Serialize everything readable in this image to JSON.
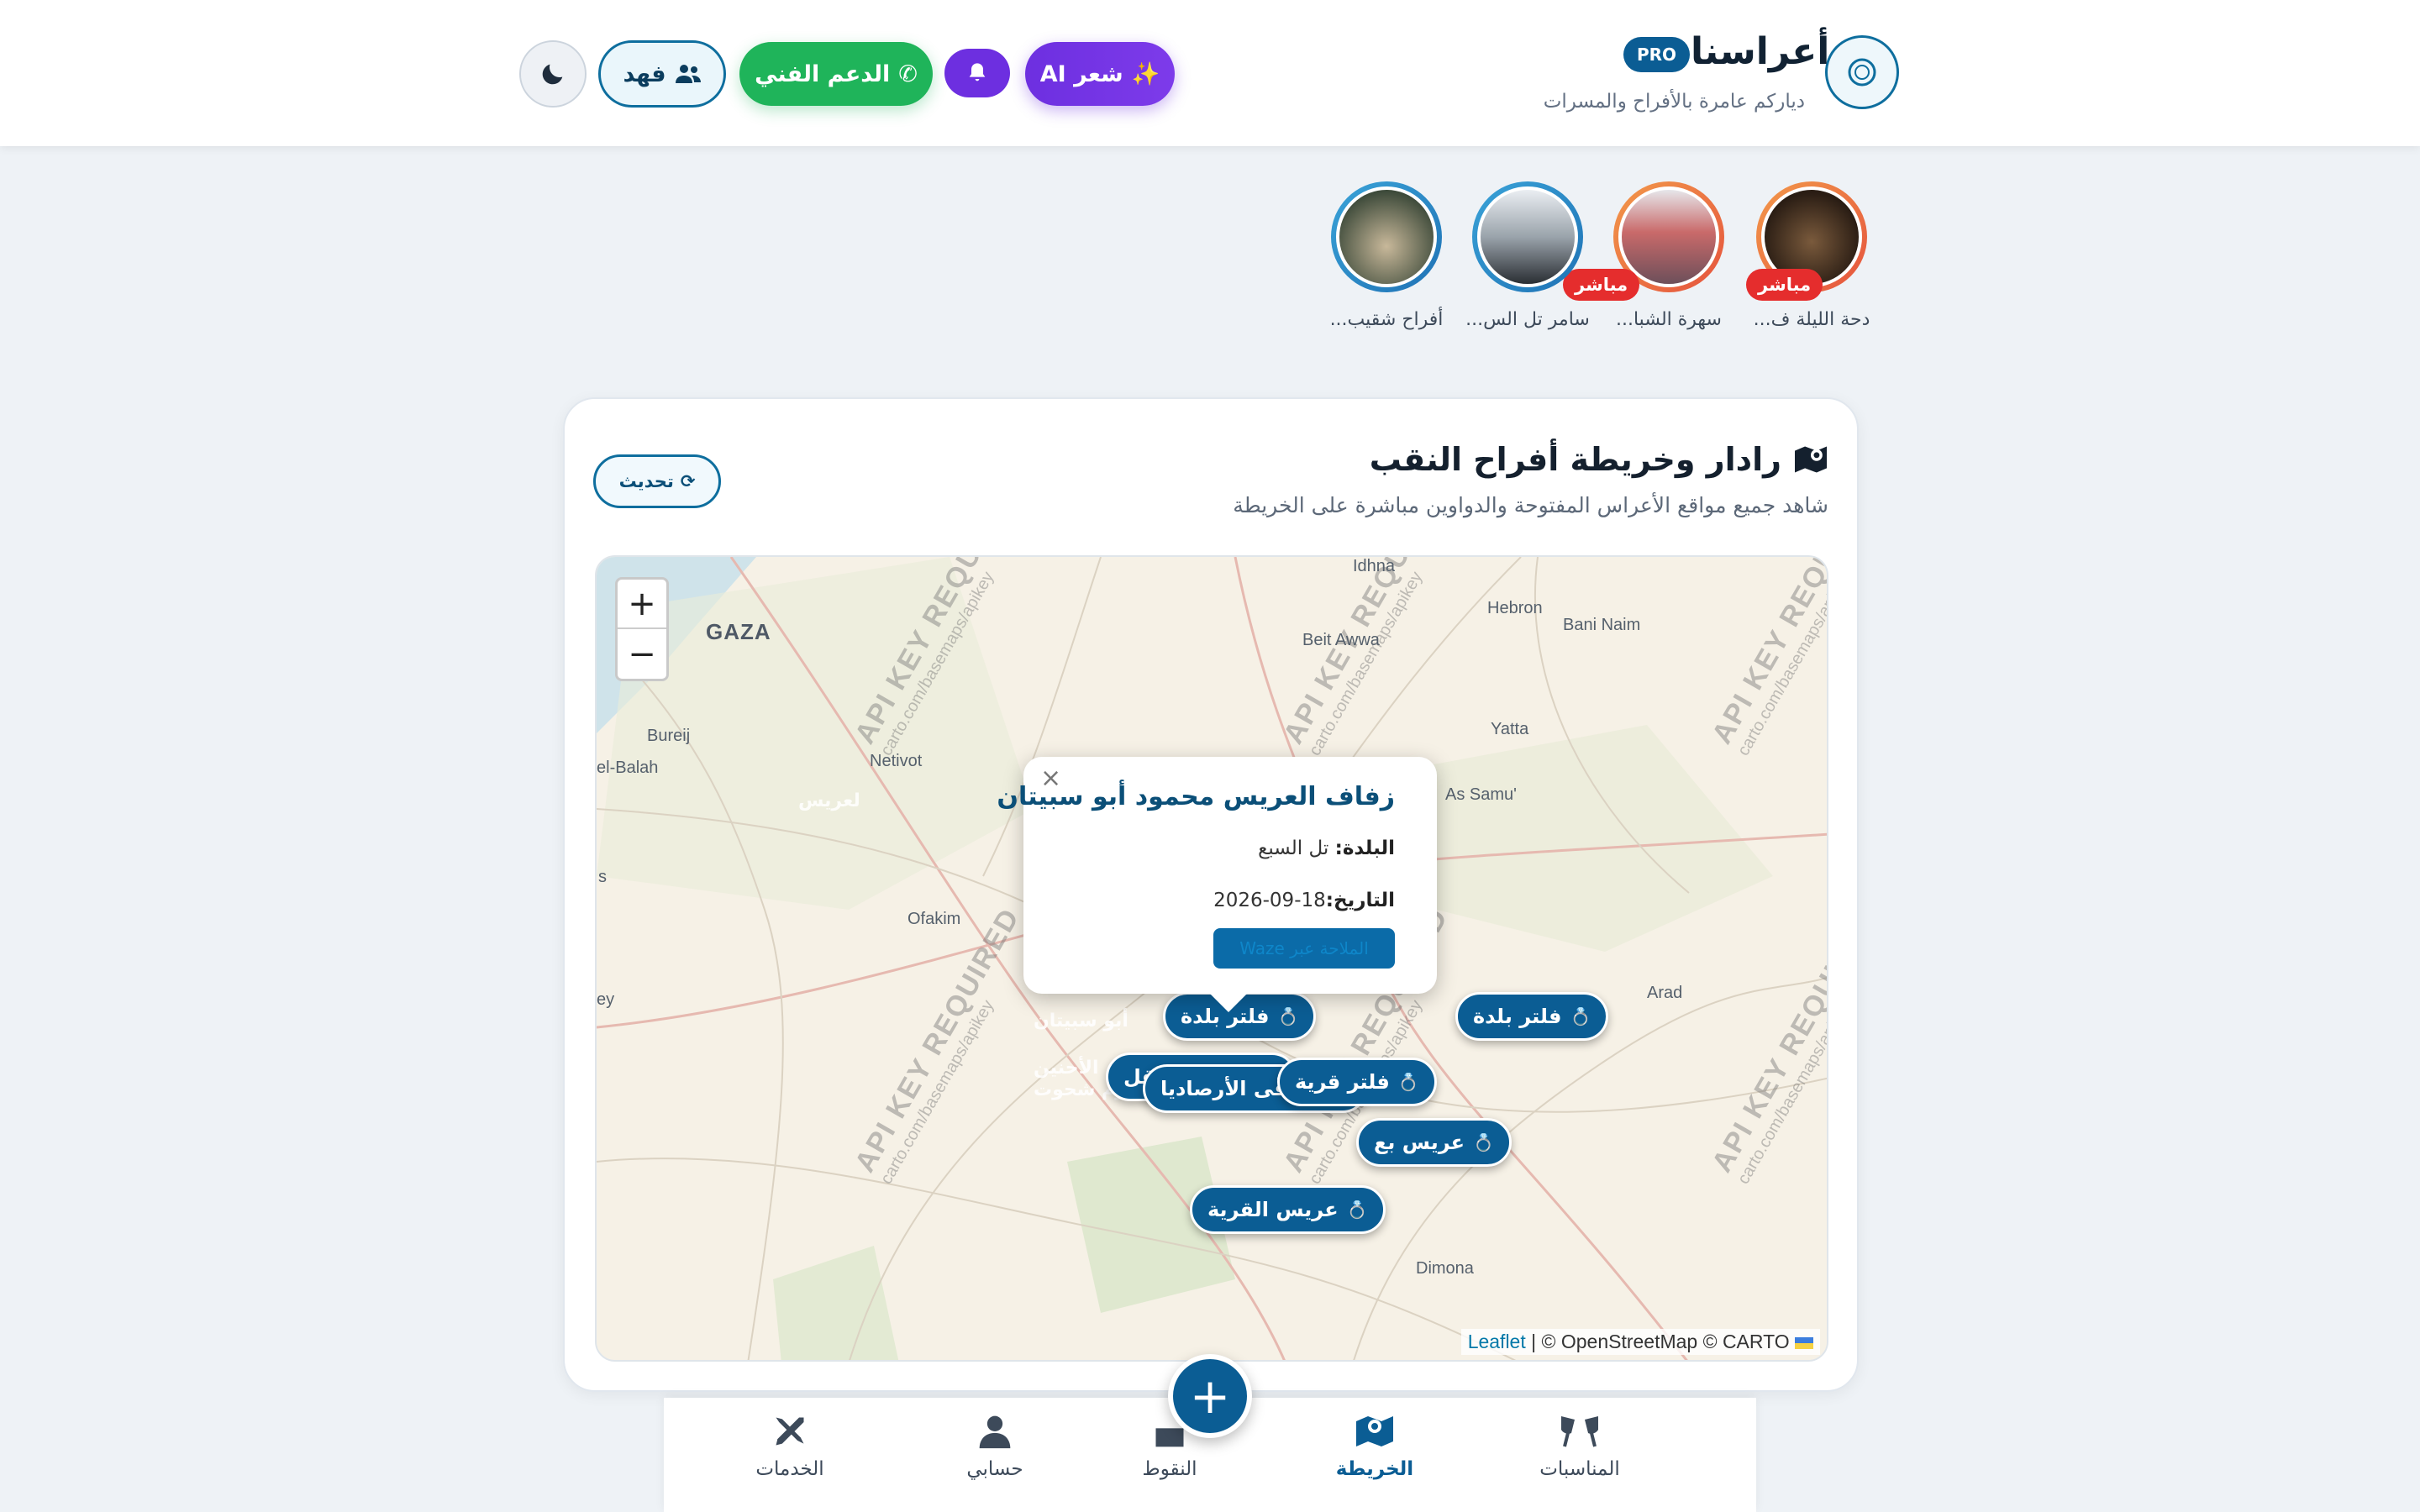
{
  "header": {
    "brand": "أعراسنا",
    "pro_badge": "PRO",
    "tagline": "دياركم عامرة بالأفراح والمسرات",
    "ai_button": "شعر AI",
    "support_button": "الدعم الفني",
    "user_button": "فهد"
  },
  "stories": [
    {
      "caption": "دحة الليلة ف...",
      "live": "مباشر"
    },
    {
      "caption": "سهرة الشبا...",
      "live": "مباشر"
    },
    {
      "caption": "سامر تل الس...",
      "live": ""
    },
    {
      "caption": "أفراح شقيب...",
      "live": ""
    }
  ],
  "radar": {
    "title": "رادار وخريطة أفراح النقب",
    "subtitle": "شاهد جميع مواقع الأعراس المفتوحة والدواوين مباشرة على الخريطة",
    "refresh": "تحديث"
  },
  "map": {
    "zoom_in": "+",
    "zoom_out": "−",
    "places": [
      "Idhna",
      "GAZA",
      "Beit Awwa",
      "Hebron",
      "Bani Naim",
      "Bureij",
      "Yatta",
      "el-Balah",
      "Netivot",
      "As Samu'",
      "Ofakim",
      "Arad",
      "Dimona",
      "s",
      "ey"
    ],
    "watermark_title": "API KEY REQUIRED",
    "watermark_url": "carto.com/basemaps/apikey",
    "markers": [
      "فلتر بلدة",
      "فلتر بلدة",
      "متوفّى الأرصاديا",
      "فلتر قرية",
      "عريس بع",
      "عريس القرية",
      "عريس ينتقل"
    ],
    "ghost_labels": [
      "لعريس",
      "أبو سبيتان",
      "عريس ينتقل إلى الأحنين",
      "لمرحوم شحوت"
    ],
    "attribution_link": "Leaflet",
    "attribution_text": " | © OpenStreetMap © CARTO"
  },
  "popup": {
    "title": "زفاف العريس محمود أبو سبيتان",
    "town_label": "البلدة:",
    "town_value": "تل السبع",
    "date_label": "التاريخ:",
    "date_value": "18-09-2026",
    "button": "الملاحة عبر Waze",
    "close": "×"
  },
  "nav": {
    "events": "المناسبات",
    "map": "الخريطة",
    "points": "النقوط",
    "account": "حسابي",
    "services": "الخدمات",
    "fab": "+"
  },
  "colors": {
    "primary": "#0b5d94",
    "ai": "#6d2fe0",
    "whatsapp": "#1fb45a",
    "live": "#e52d2d"
  }
}
